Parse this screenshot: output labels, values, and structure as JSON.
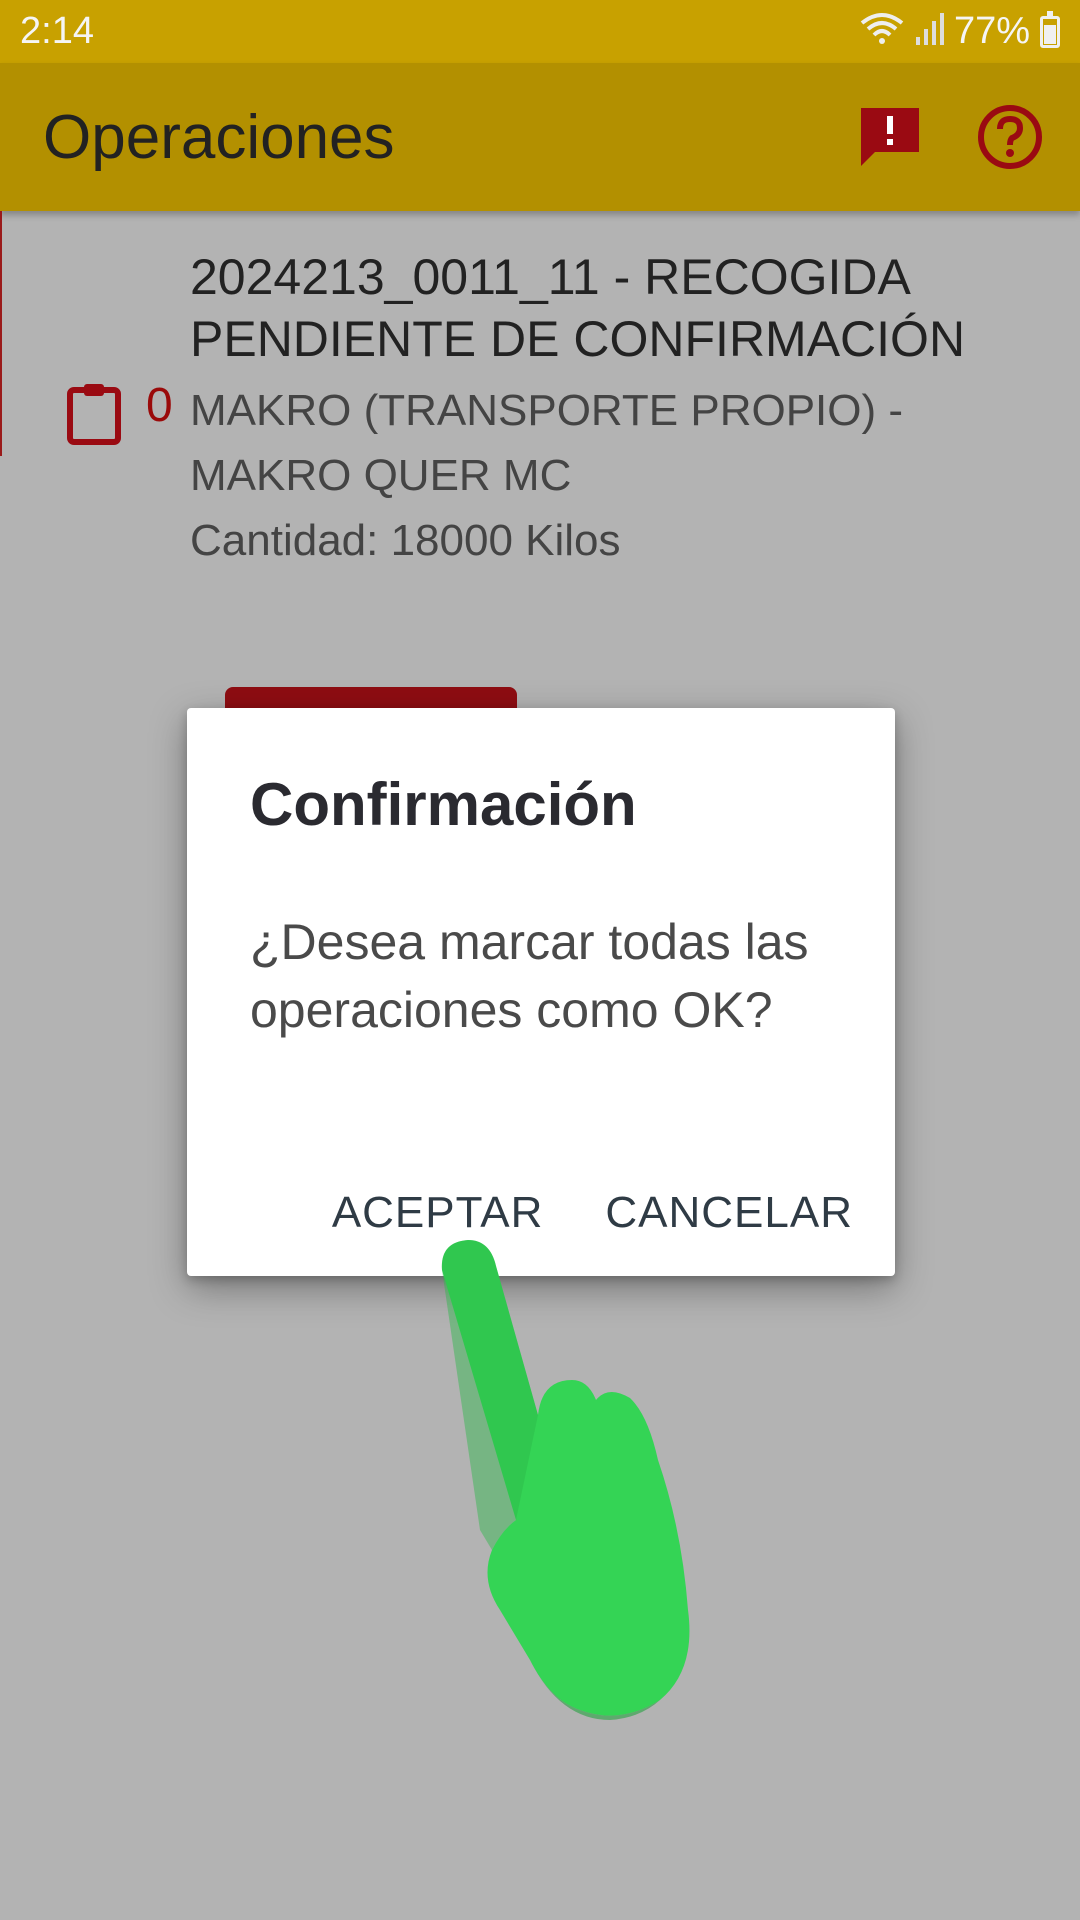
{
  "status_bar": {
    "time": "2:14",
    "battery": "77%"
  },
  "app_bar": {
    "title": "Operaciones",
    "icons": [
      "feedback-icon",
      "help-icon"
    ]
  },
  "list_item": {
    "count": "0",
    "title": "2024213_0011_11 - RECOGIDA PENDIENTE DE CONFIRMACIÓN",
    "client": "MAKRO (TRANSPORTE PROPIO) - MAKRO QUER MC",
    "quantity": "Cantidad: 18000 Kilos"
  },
  "dialog": {
    "title": "Confirmación",
    "message": "¿Desea marcar todas las operaciones como OK?",
    "accept_label": "ACEPTAR",
    "cancel_label": "CANCELAR"
  },
  "colors": {
    "status_bar": "#c8a100",
    "app_bar": "#b39000",
    "accent_red": "#9a0a0a",
    "hand": "#34d455"
  }
}
